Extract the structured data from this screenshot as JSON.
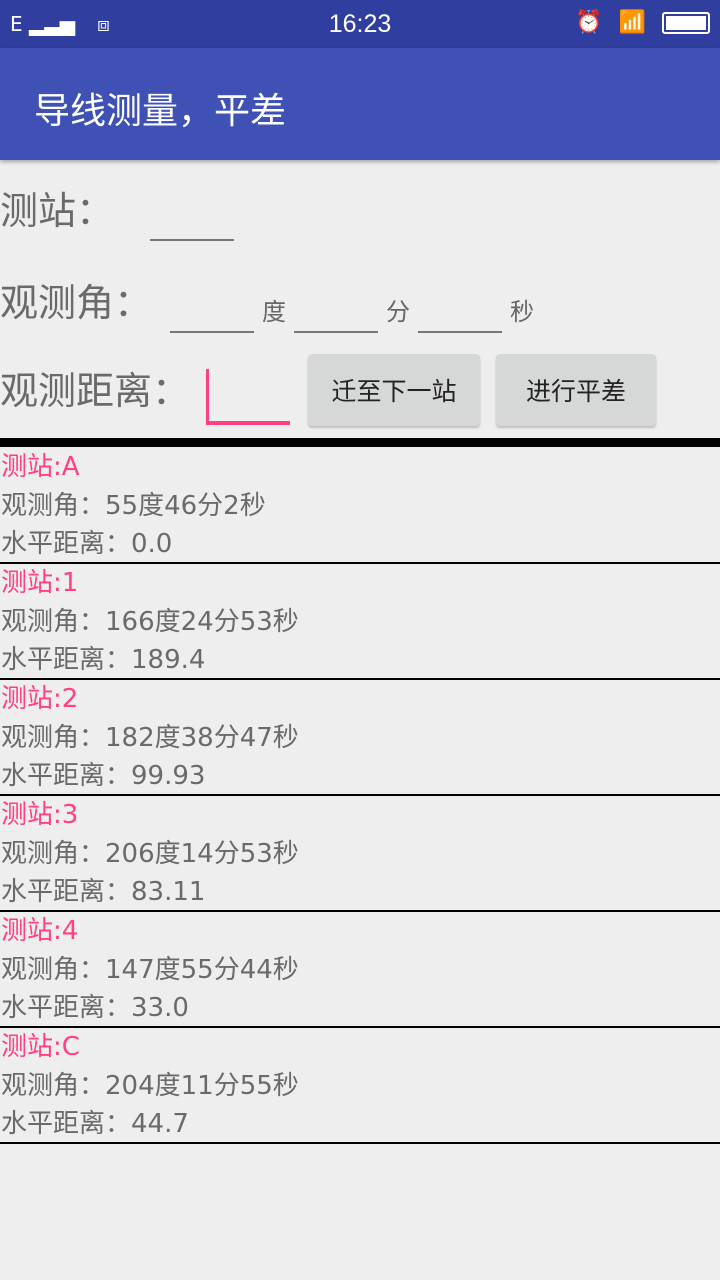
{
  "status_bar": {
    "network": "E",
    "time": "16:23"
  },
  "app_bar": {
    "title": "导线测量，平差"
  },
  "form": {
    "station_label": "测站：",
    "angle_label": "观测角：",
    "deg_unit": "度",
    "min_unit": "分",
    "sec_unit": "秒",
    "distance_label": "观测距离：",
    "next_station_button": "迁至下一站",
    "adjust_button": "进行平差",
    "accent": "#ff4081"
  },
  "stations": [
    {
      "station": "测站:A",
      "angle": "观测角：55度46分2秒",
      "distance": "水平距离：0.0"
    },
    {
      "station": "测站:1",
      "angle": "观测角：166度24分53秒",
      "distance": "水平距离：189.4"
    },
    {
      "station": "测站:2",
      "angle": "观测角：182度38分47秒",
      "distance": "水平距离：99.93"
    },
    {
      "station": "测站:3",
      "angle": "观测角：206度14分53秒",
      "distance": "水平距离：83.11"
    },
    {
      "station": "测站:4",
      "angle": "观测角：147度55分44秒",
      "distance": "水平距离：33.0"
    },
    {
      "station": "测站:C",
      "angle": "观测角：204度11分55秒",
      "distance": "水平距离：44.7"
    }
  ]
}
